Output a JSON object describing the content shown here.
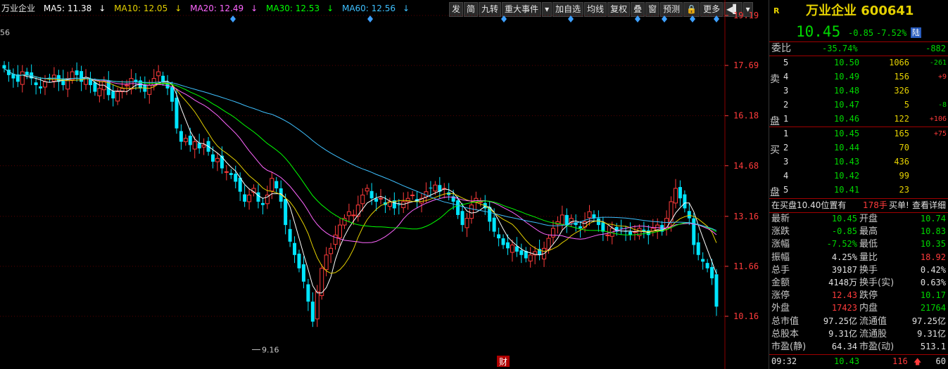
{
  "ma_bar": {
    "name": "万业企业",
    "ma5": "MA5: 11.38",
    "ma10": "MA10: 12.05",
    "ma20": "MA20: 12.49",
    "ma30": "MA30: 12.53",
    "ma60": "MA60: 12.56",
    "down_arrow": "↓",
    "colors": {
      "ma5": "#ffffff",
      "ma10": "#e5d100",
      "ma20": "#ff66ff",
      "ma30": "#00ff00",
      "ma60": "#3ec0ff"
    }
  },
  "toolbar": [
    "发",
    "简",
    "九转",
    "重大事件",
    "▾",
    "加自选",
    "均线",
    "复权",
    "叠",
    "窗",
    "预测",
    "🔒",
    "更多",
    "◀▌",
    "▾"
  ],
  "price_axis": [
    "19.19",
    "17.69",
    "16.18",
    "14.68",
    "13.16",
    "11.66",
    "10.16"
  ],
  "left_edge_label": "56",
  "low_marker": "9.16",
  "fin_marker": "财",
  "quote": {
    "r_badge": "R",
    "title": "万业企业 600641",
    "price": "10.45",
    "change": "-0.85",
    "pct": "-7.52%",
    "board": "陆",
    "weibi_label": "委比",
    "weibi_pct": "-35.74%",
    "weibi_diff": "-882",
    "sell_label": "卖\n\n盘",
    "buy_label": "买\n\n盘",
    "sells": [
      {
        "lvl": "5",
        "price": "10.50",
        "vol": "1066",
        "chg": "-261"
      },
      {
        "lvl": "4",
        "price": "10.49",
        "vol": "156",
        "chg": "+9"
      },
      {
        "lvl": "3",
        "price": "10.48",
        "vol": "326",
        "chg": ""
      },
      {
        "lvl": "2",
        "price": "10.47",
        "vol": "5",
        "chg": "-8"
      },
      {
        "lvl": "1",
        "price": "10.46",
        "vol": "122",
        "chg": "+106"
      }
    ],
    "buys": [
      {
        "lvl": "1",
        "price": "10.45",
        "vol": "165",
        "chg": "+75"
      },
      {
        "lvl": "2",
        "price": "10.44",
        "vol": "70",
        "chg": ""
      },
      {
        "lvl": "3",
        "price": "10.43",
        "vol": "436",
        "chg": ""
      },
      {
        "lvl": "4",
        "price": "10.42",
        "vol": "99",
        "chg": ""
      },
      {
        "lvl": "5",
        "price": "10.41",
        "vol": "23",
        "chg": ""
      }
    ],
    "notice": "在买盘10.40位置有",
    "notice_vol": "178手",
    "notice_tail": "买单!",
    "detail_link": "查看详细",
    "stats": [
      {
        "l1": "最新",
        "v1": "10.45",
        "c1": "green",
        "l2": "开盘",
        "v2": "10.74",
        "c2": "green"
      },
      {
        "l1": "涨跌",
        "v1": "-0.85",
        "c1": "green",
        "l2": "最高",
        "v2": "10.83",
        "c2": "green"
      },
      {
        "l1": "涨幅",
        "v1": "-7.52%",
        "c1": "green",
        "l2": "最低",
        "v2": "10.35",
        "c2": "green"
      },
      {
        "l1": "振幅",
        "v1": "4.25%",
        "c1": "white",
        "l2": "量比",
        "v2": "18.92",
        "c2": "red"
      },
      {
        "l1": "总手",
        "v1": "39187",
        "c1": "white",
        "l2": "换手",
        "v2": "0.42%",
        "c2": "white"
      },
      {
        "l1": "金额",
        "v1": "4148万",
        "c1": "white",
        "l2": "换手(实)",
        "v2": "0.63%",
        "c2": "white"
      },
      {
        "l1": "涨停",
        "v1": "12.43",
        "c1": "red",
        "l2": "跌停",
        "v2": "10.17",
        "c2": "green"
      },
      {
        "l1": "外盘",
        "v1": "17423",
        "c1": "red",
        "l2": "内盘",
        "v2": "21764",
        "c2": "green"
      },
      {
        "l1": "总市值",
        "v1": "97.25亿",
        "c1": "white",
        "l2": "流通值",
        "v2": "97.25亿",
        "c2": "white"
      },
      {
        "l1": "总股本",
        "v1": "9.31亿",
        "c1": "white",
        "l2": "流通股",
        "v2": "9.31亿",
        "c2": "white"
      },
      {
        "l1": "市盈(静)",
        "v1": "64.34",
        "c1": "white",
        "l2": "市盈(动)",
        "v2": "513.1",
        "c2": "white"
      }
    ],
    "tick": {
      "time": "09:32",
      "price": "10.43",
      "vol": "116",
      "arrow": "🡅",
      "count": "60"
    }
  },
  "colors": {
    "up": "#ff3b3b",
    "down": "#00e5ff",
    "grid": "#6b0000",
    "axis": "#ff3b3b"
  }
}
